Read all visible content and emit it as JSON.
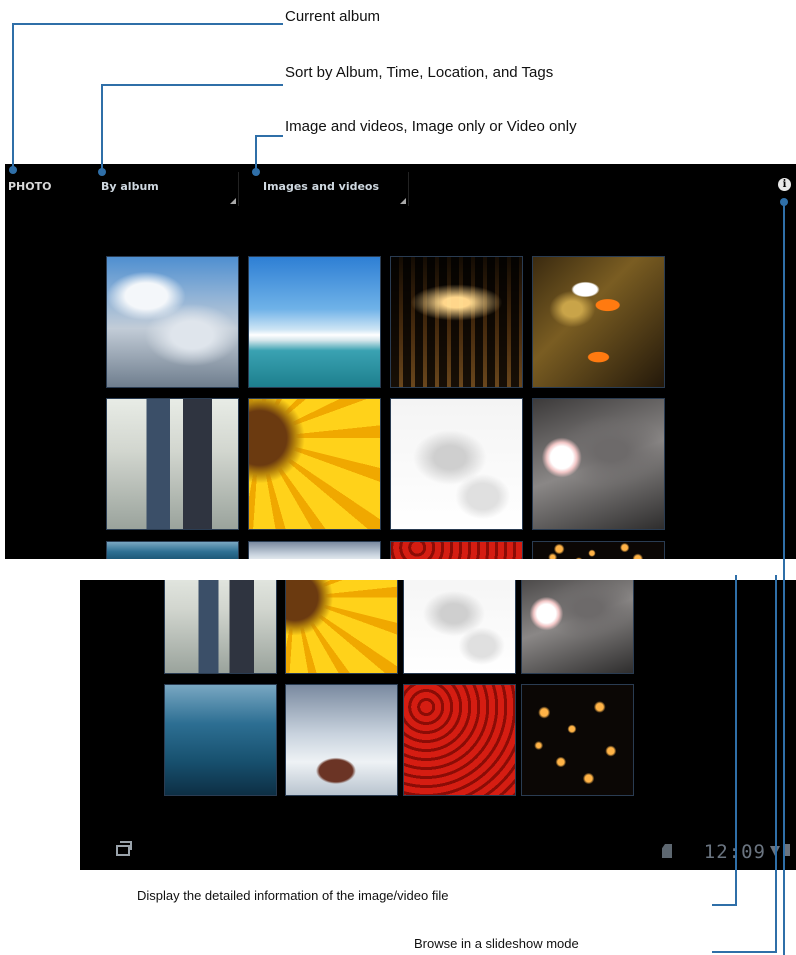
{
  "callouts": {
    "current_album": "Current album",
    "sort_by": "Sort by Album, Time, Location, and Tags",
    "media_filter": "Image and videos, Image only or Video only",
    "details": "Display the detailed information of the image/video file",
    "slideshow": "Browse in a slideshow mode"
  },
  "action_bar": {
    "album_label": "PHOTO",
    "sort_dropdown_value": "By album",
    "type_dropdown_value": "Images and videos",
    "info_icon_glyph": "i"
  },
  "grid_tiles": [
    {
      "name": "sky-clouds-photo"
    },
    {
      "name": "harbor-boat-photo"
    },
    {
      "name": "lit-building-photo"
    },
    {
      "name": "clownfish-photo"
    },
    {
      "name": "couple-walking-photo"
    },
    {
      "name": "sunflower-photo"
    },
    {
      "name": "sleeping-cat-photo"
    },
    {
      "name": "white-blossom-photo"
    },
    {
      "name": "blue-lake-photo"
    },
    {
      "name": "rock-in-water-photo"
    },
    {
      "name": "red-pattern-photo"
    },
    {
      "name": "sky-lanterns-photo"
    }
  ],
  "status_bar": {
    "time": "12:09"
  },
  "colors": {
    "screen_background": "#000000",
    "callout_line": "#2f6fa8",
    "tile_border": "#2a3c52"
  }
}
